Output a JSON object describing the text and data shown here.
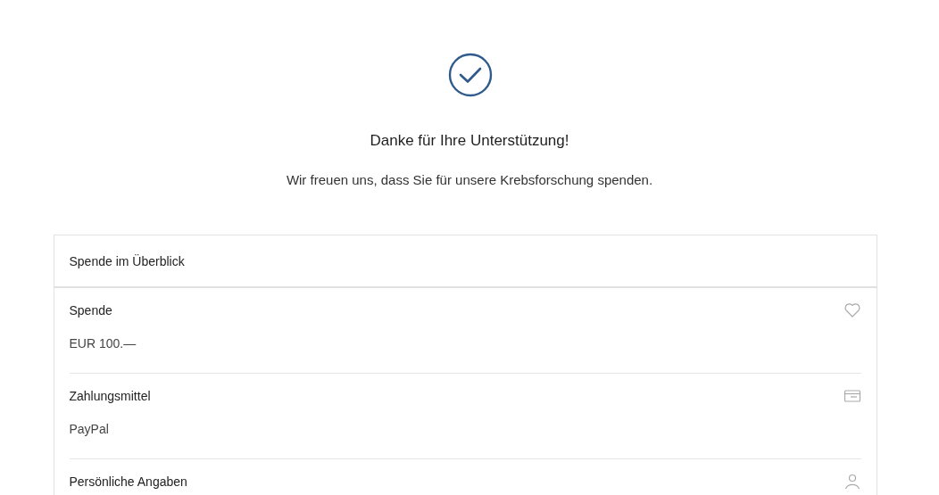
{
  "confirmation": {
    "title": "Danke für Ihre Unterstützung!",
    "message": "Wir freuen uns, dass Sie für unsere Krebsforschung spenden."
  },
  "summary": {
    "title": "Spende im Überblick",
    "sections": [
      {
        "label": "Spende",
        "value": "EUR 100.—"
      },
      {
        "label": "Zahlungsmittel",
        "value": "PayPal"
      },
      {
        "label": "Persönliche Angaben"
      }
    ]
  }
}
